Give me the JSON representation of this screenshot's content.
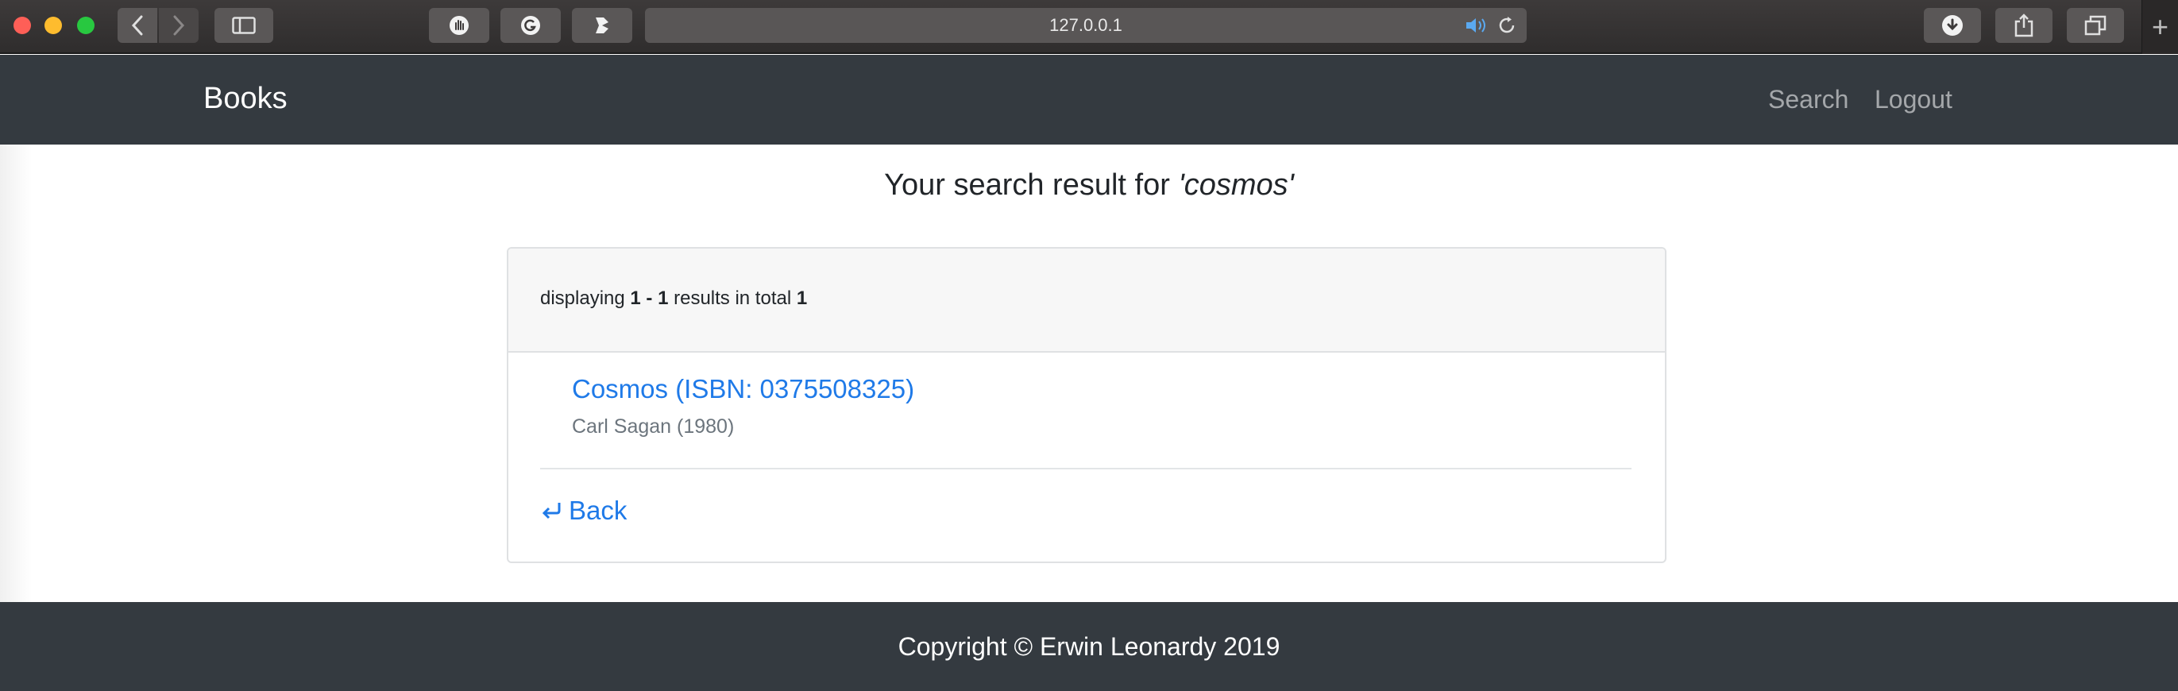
{
  "browser": {
    "url": "127.0.0.1"
  },
  "navbar": {
    "brand": "Books",
    "links": [
      "Search",
      "Logout"
    ]
  },
  "heading": {
    "prefix": "Your search result for ",
    "query": "'cosmos'"
  },
  "results_summary": {
    "prefix": "displaying ",
    "range": "1 - 1",
    "middle": " results in total ",
    "total": "1"
  },
  "results": [
    {
      "title": "Cosmos (ISBN: 0375508325)",
      "meta": "Carl Sagan (1980)"
    }
  ],
  "back_label": "Back",
  "back_icon": "return-arrow-icon",
  "footer": {
    "copyright": "Copyright © Erwin Leonardy 2019"
  },
  "colors": {
    "navbar_bg": "#343a40",
    "link": "#1f7ae8",
    "muted": "#6c757d"
  }
}
